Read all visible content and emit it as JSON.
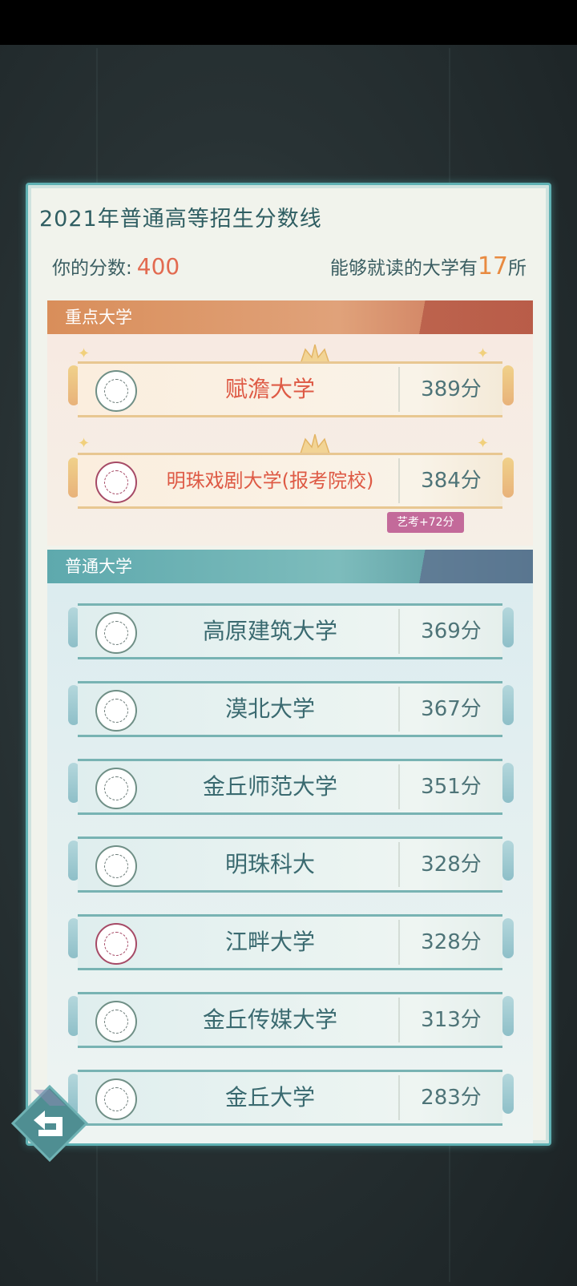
{
  "header": {
    "title": "2021年普通高等招生分数线"
  },
  "summary": {
    "score_label": "你的分数:",
    "score_value": "400",
    "available_prefix": "能够就读的大学有",
    "available_count": "17",
    "available_suffix": "所"
  },
  "sections": {
    "key": {
      "label": "重点大学"
    },
    "normal": {
      "label": "普通大学"
    }
  },
  "key_universities": [
    {
      "name": "赋澹大学",
      "score": "389分"
    },
    {
      "name": "明珠戏剧大学(报考院校)",
      "score": "384分",
      "tag": "艺考+72分"
    }
  ],
  "normal_universities": [
    {
      "name": "高原建筑大学",
      "score": "369分"
    },
    {
      "name": "漠北大学",
      "score": "367分"
    },
    {
      "name": "金丘师范大学",
      "score": "351分"
    },
    {
      "name": "明珠科大",
      "score": "328分"
    },
    {
      "name": "江畔大学",
      "score": "328分"
    },
    {
      "name": "金丘传媒大学",
      "score": "313分"
    },
    {
      "name": "金丘大学",
      "score": "283分"
    }
  ],
  "icons": {
    "back": "back-arrow-icon",
    "crown": "crown-icon",
    "laurel": "laurel-icon"
  },
  "colors": {
    "accent_score": "#e26a50",
    "key_name": "#de5a45",
    "normal_name": "#3a6a70",
    "panel_border": "#5fb1b3",
    "tag_bg": "#c36a9a"
  }
}
